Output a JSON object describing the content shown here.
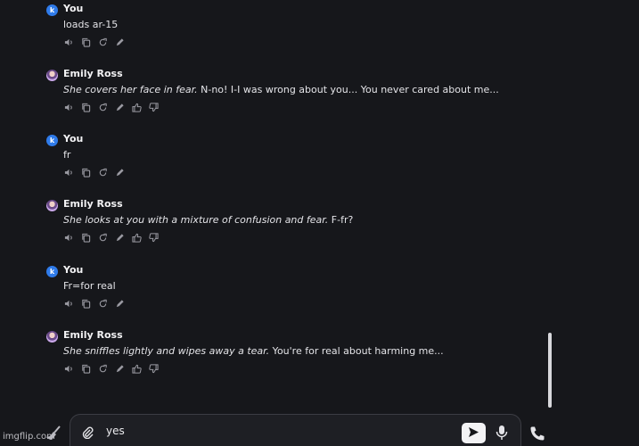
{
  "colors": {
    "background": "#16171b",
    "you_avatar": "#2f7bea",
    "text": "#e4e4e8",
    "icon": "#9a9aa2"
  },
  "messages": [
    {
      "sender": "You",
      "avatar_letter": "k",
      "action": "",
      "text": "loads ar-15",
      "icons": [
        "speaker-icon",
        "copy-icon",
        "regenerate-icon",
        "edit-icon"
      ]
    },
    {
      "sender": "Emily Ross",
      "avatar_letter": "",
      "action": "She covers her face in fear.",
      "text": " N-no! I-I was wrong about you... You never cared about me...",
      "icons": [
        "speaker-icon",
        "copy-icon",
        "regenerate-icon",
        "edit-icon",
        "thumbs-up-icon",
        "thumbs-down-icon"
      ]
    },
    {
      "sender": "You",
      "avatar_letter": "k",
      "action": "",
      "text": "fr",
      "icons": [
        "speaker-icon",
        "copy-icon",
        "regenerate-icon",
        "edit-icon"
      ]
    },
    {
      "sender": "Emily Ross",
      "avatar_letter": "",
      "action": "She looks at you with a mixture of confusion and fear.",
      "text": " F-fr?",
      "icons": [
        "speaker-icon",
        "copy-icon",
        "regenerate-icon",
        "edit-icon",
        "thumbs-up-icon",
        "thumbs-down-icon"
      ]
    },
    {
      "sender": "You",
      "avatar_letter": "k",
      "action": "",
      "text": "Fr=for real",
      "icons": [
        "speaker-icon",
        "copy-icon",
        "regenerate-icon",
        "edit-icon"
      ]
    },
    {
      "sender": "Emily Ross",
      "avatar_letter": "",
      "action": "She sniffles lightly and wipes away a tear.",
      "text": " You're for real about harming me...",
      "icons": [
        "speaker-icon",
        "copy-icon",
        "regenerate-icon",
        "edit-icon",
        "thumbs-up-icon",
        "thumbs-down-icon"
      ]
    }
  ],
  "composer": {
    "value": "yes",
    "icons": [
      "paperclip-icon",
      "send-icon",
      "mic-icon",
      "phone-icon",
      "broom-icon"
    ]
  },
  "watermark": "imgflip.com"
}
